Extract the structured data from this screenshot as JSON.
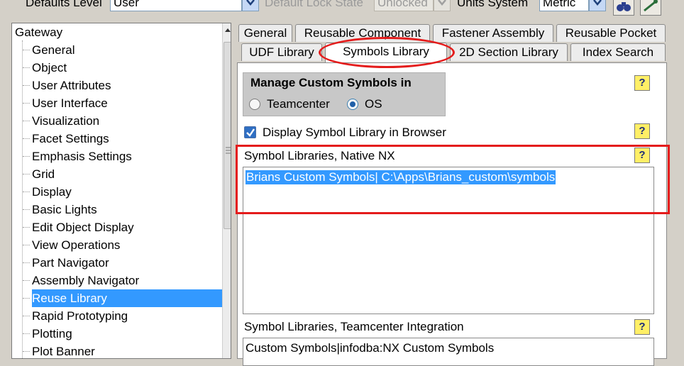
{
  "topbar": {
    "defaults_level_label": "Defaults Level",
    "defaults_level_value": "User",
    "default_lock_state_label": "Default Lock State",
    "default_lock_state_value": "Unlocked",
    "units_system_label": "Units System",
    "units_system_value": "Metric"
  },
  "tree": {
    "root": "Gateway",
    "items": [
      "General",
      "Object",
      "User Attributes",
      "User Interface",
      "Visualization",
      "Facet Settings",
      "Emphasis Settings",
      "Grid",
      "Display",
      "Basic Lights",
      "Edit Object Display",
      "View Operations",
      "Part Navigator",
      "Assembly Navigator",
      "Reuse Library",
      "Rapid Prototyping",
      "Plotting",
      "Plot Banner"
    ],
    "selected_index": 14
  },
  "tabs": {
    "row1": [
      "General",
      "Reusable Component",
      "Fastener Assembly",
      "Reusable Pocket"
    ],
    "row2": [
      "UDF Library",
      "Symbols Library",
      "2D Section Library",
      "Index Search"
    ],
    "active": "Symbols Library"
  },
  "panel": {
    "manage_title": "Manage Custom Symbols in",
    "radio_teamcenter": "Teamcenter",
    "radio_os": "OS",
    "selected_radio": "OS",
    "display_checkbox_label": "Display Symbol Library in Browser",
    "display_checkbox_checked": true,
    "native_label": "Symbol Libraries, Native NX",
    "native_value": "Brians Custom Symbols| C:\\Apps\\Brians_custom\\symbols",
    "tc_label": "Symbol Libraries, Teamcenter Integration",
    "tc_value": "Custom Symbols|infodba:NX Custom Symbols",
    "help_glyph": "?"
  },
  "colors": {
    "highlight": "#3399ff",
    "annotation_red": "#e41b1b",
    "help_yellow": "#ffef66"
  }
}
